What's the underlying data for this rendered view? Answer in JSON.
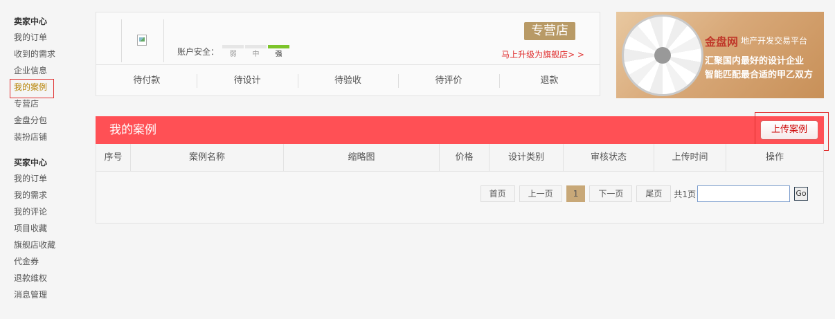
{
  "sidebar": {
    "seller_title": "卖家中心",
    "seller_items": [
      "我的订单",
      "收到的需求",
      "企业信息",
      "我的案例",
      "专营店",
      "金盘分包",
      "装扮店铺"
    ],
    "buyer_title": "买家中心",
    "buyer_items": [
      "我的订单",
      "我的需求",
      "我的评论",
      "项目收藏",
      "旗舰店收藏",
      "代金券",
      "退款维权",
      "消息管理"
    ]
  },
  "account": {
    "security_label": "账户安全：",
    "security_levels": [
      "弱",
      "中",
      "强"
    ],
    "security_level": 3,
    "shop_badge": "专营店",
    "upgrade_link": "马上升级为旗舰店> >",
    "tabs": [
      "待付款",
      "待设计",
      "待验收",
      "待评价",
      "退款"
    ]
  },
  "ad": {
    "logo_main": "金盘网",
    "logo_tag": "地产开发交易平台",
    "line1": "汇聚国内最好的设计企业",
    "line2": "智能匹配最合适的甲乙双方"
  },
  "cases": {
    "title": "我的案例",
    "upload_button": "上传案例",
    "columns": [
      "序号",
      "案例名称",
      "缩略图",
      "价格",
      "设计类别",
      "审核状态",
      "上传时间",
      "操作"
    ]
  },
  "pager": {
    "first": "首页",
    "prev": "上一页",
    "current": "1",
    "next": "下一页",
    "last": "尾页",
    "total": "共1页",
    "go": "Go"
  },
  "colors": {
    "header_red": "#ff5055",
    "accent_gold": "#b89a66",
    "security_green": "#7cc42a"
  }
}
